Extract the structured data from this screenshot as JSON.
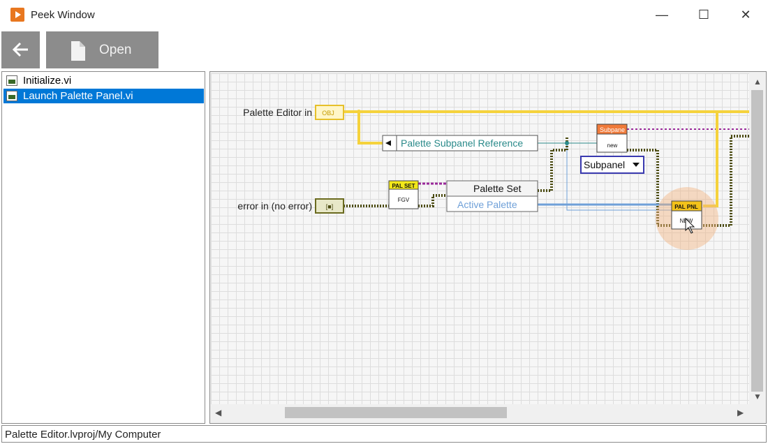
{
  "window": {
    "title": "Peek Window",
    "minimize": "—",
    "maximize": "☐",
    "close": "✕"
  },
  "toolbar": {
    "back_icon": "arrow-left-icon",
    "open_label": "Open"
  },
  "tree": {
    "items": [
      {
        "label": "Initialize.vi",
        "selected": false
      },
      {
        "label": "Launch Palette Panel.vi",
        "selected": true
      }
    ]
  },
  "diagram": {
    "labels": {
      "palette_editor_in": "Palette Editor in",
      "error_in": "error in (no error)",
      "obj": "OBJ",
      "err_cluster": "[■]",
      "palette_subpanel_ref": "Palette Subpanel Reference",
      "palset_header": "PAL SET",
      "palset_body": "FGV",
      "palette_set": "Palette Set",
      "active_palette": "Active Palette",
      "subpanel_header": "Subpane",
      "subpanel_body": "new",
      "subpanel_enum": "Subpanel",
      "palpnl_header": "PAL PNL",
      "palpnl_body": "NEW"
    }
  },
  "status": {
    "path": "Palette Editor.lvproj/My Computer"
  },
  "colors": {
    "accent": "#0078d7",
    "wire_yellow": "#f5d23c",
    "wire_dark": "#4a4a10",
    "toolbar_button": "#8c8c8c",
    "teal_text": "#2a8a8a",
    "blue_text": "#6fa0d8"
  }
}
